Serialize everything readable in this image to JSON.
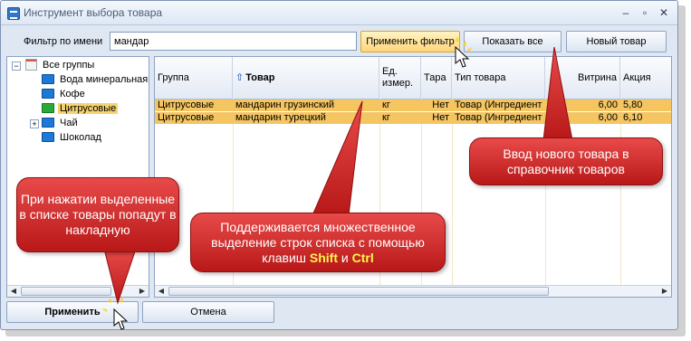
{
  "window": {
    "title": "Инструмент выбора товара"
  },
  "filter": {
    "label": "Фильтр по имени",
    "value": "мандар"
  },
  "buttons": {
    "apply_filter": "Применить фильтр",
    "show_all": "Показать все",
    "new_item": "Новый товар",
    "apply": "Применить",
    "cancel": "Отмена"
  },
  "tree": {
    "root": "Все группы",
    "items": [
      "Вода минеральная",
      "Кофе",
      "Цитрусовые",
      "Чай",
      "Шоколад"
    ],
    "selected": "Цитрусовые"
  },
  "grid": {
    "columns": [
      "Группа",
      "Товар",
      "Ед. измер.",
      "Тара",
      "Тип товара",
      "Витрина",
      "Акция"
    ],
    "rows": [
      [
        "Цитрусовые",
        "мандарин грузинский",
        "кг",
        "Нет",
        "Товар (Ингредиент",
        "6,00",
        "5,80"
      ],
      [
        "Цитрусовые",
        "мандарин турецкий",
        "кг",
        "Нет",
        "Товар (Ингредиент",
        "6,00",
        "6,10"
      ]
    ]
  },
  "callouts": {
    "new_item": "Ввод нового товара в справочник товаров",
    "multi_select_prefix": "Поддерживается множественное выделение строк списка с помощью клавиш",
    "key_shift": "Shift",
    "and": "и",
    "key_ctrl": "Ctrl",
    "apply_hint": "При нажатии выделенные в списке товары попадут в накладную"
  },
  "colors": {
    "selection": "#f4c561",
    "callout": "#d42a2a",
    "accent": "#1e78d8"
  }
}
